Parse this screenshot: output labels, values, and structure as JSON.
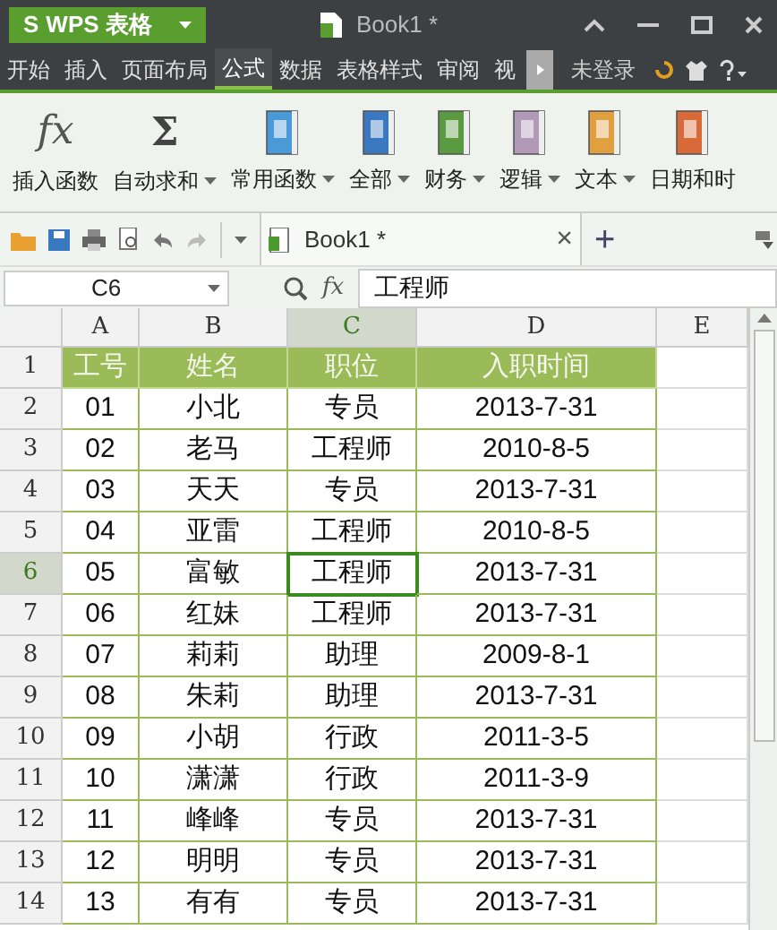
{
  "app_button": {
    "logo": "S",
    "label": "WPS 表格"
  },
  "window": {
    "title": "Book1 *"
  },
  "menu_tabs": [
    {
      "label": "开始",
      "selected": false
    },
    {
      "label": "插入",
      "selected": false
    },
    {
      "label": "页面布局",
      "selected": false
    },
    {
      "label": "公式",
      "selected": true
    },
    {
      "label": "数据",
      "selected": false
    },
    {
      "label": "表格样式",
      "selected": false
    },
    {
      "label": "审阅",
      "selected": false
    },
    {
      "label": "视",
      "selected": false
    }
  ],
  "login": "未登录",
  "ribbon": [
    {
      "kind": "fx",
      "symbol": "fx",
      "label": "插入函数",
      "dropdown": false
    },
    {
      "kind": "sum",
      "symbol": "Σ",
      "label": "自动求和",
      "dropdown": true
    },
    {
      "kind": "book",
      "color": "#4a9ad8",
      "label": "常用函数",
      "dropdown": true
    },
    {
      "kind": "book",
      "color": "#3a78c0",
      "label": "全部",
      "dropdown": true
    },
    {
      "kind": "book",
      "color": "#5a9a40",
      "label": "财务",
      "dropdown": true
    },
    {
      "kind": "book",
      "color": "#b09ab8",
      "label": "逻辑",
      "dropdown": true
    },
    {
      "kind": "book",
      "color": "#e0a040",
      "label": "文本",
      "dropdown": true
    },
    {
      "kind": "book",
      "color": "#d86a3a",
      "label": "日期和时",
      "dropdown": false
    }
  ],
  "doc_tab": {
    "label": "Book1 *",
    "close": "×",
    "new": "+"
  },
  "formula_bar": {
    "cell": "C6",
    "fx": "fx",
    "value": "工程师"
  },
  "columns": [
    {
      "label": "A",
      "selected": false
    },
    {
      "label": "B",
      "selected": false
    },
    {
      "label": "C",
      "selected": true
    },
    {
      "label": "D",
      "selected": false
    },
    {
      "label": "E",
      "selected": false
    }
  ],
  "rows": [
    {
      "number": "1",
      "selected": false,
      "header": true,
      "cells": [
        "工号",
        "姓名",
        "职位",
        "入职时间"
      ]
    },
    {
      "number": "2",
      "selected": false,
      "cells": [
        "01",
        "小北",
        "专员",
        "2013-7-31"
      ]
    },
    {
      "number": "3",
      "selected": false,
      "cells": [
        "02",
        "老马",
        "工程师",
        "2010-8-5"
      ]
    },
    {
      "number": "4",
      "selected": false,
      "cells": [
        "03",
        "天天",
        "专员",
        "2013-7-31"
      ]
    },
    {
      "number": "5",
      "selected": false,
      "cells": [
        "04",
        "亚雷",
        "工程师",
        "2010-8-5"
      ]
    },
    {
      "number": "6",
      "selected": true,
      "cells": [
        "05",
        "富敏",
        "工程师",
        "2013-7-31"
      ]
    },
    {
      "number": "7",
      "selected": false,
      "cells": [
        "06",
        "红妹",
        "工程师",
        "2013-7-31"
      ]
    },
    {
      "number": "8",
      "selected": false,
      "cells": [
        "07",
        "莉莉",
        "助理",
        "2009-8-1"
      ]
    },
    {
      "number": "9",
      "selected": false,
      "cells": [
        "08",
        "朱莉",
        "助理",
        "2013-7-31"
      ]
    },
    {
      "number": "10",
      "selected": false,
      "cells": [
        "09",
        "小胡",
        "行政",
        "2011-3-5"
      ]
    },
    {
      "number": "11",
      "selected": false,
      "cells": [
        "10",
        "潇潇",
        "行政",
        "2011-3-9"
      ]
    },
    {
      "number": "12",
      "selected": false,
      "cells": [
        "11",
        "峰峰",
        "专员",
        "2013-7-31"
      ]
    },
    {
      "number": "13",
      "selected": false,
      "cells": [
        "12",
        "明明",
        "专员",
        "2013-7-31"
      ]
    },
    {
      "number": "14",
      "selected": false,
      "cells": [
        "13",
        "有有",
        "专员",
        "2013-7-31"
      ]
    }
  ]
}
